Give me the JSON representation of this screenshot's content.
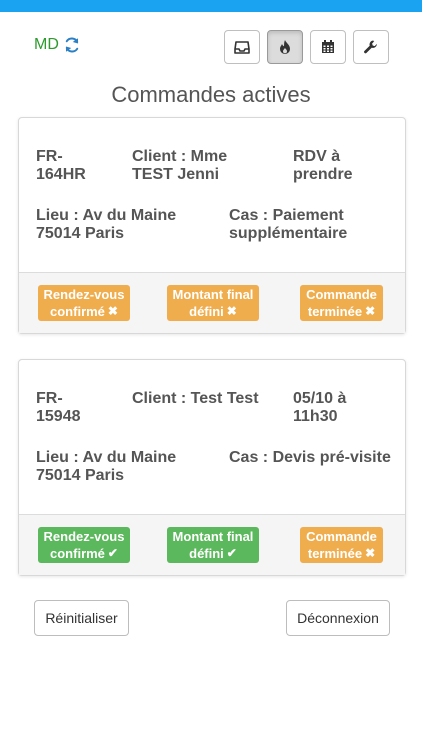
{
  "header": {
    "brand": "MD",
    "nav_icons": [
      "inbox-icon",
      "fire-icon",
      "calendar-icon",
      "wrench-icon"
    ],
    "active_icon": "fire-icon"
  },
  "page_title": "Commandes actives",
  "orders": [
    {
      "id_l1": "FR-",
      "id_l2": "164HR",
      "client_l1": "Client : Mme",
      "client_l2": "TEST Jenni",
      "rdv_l1": "RDV à",
      "rdv_l2": "prendre",
      "lieu_l1": "Lieu : Av du Maine",
      "lieu_l2": "75014 Paris",
      "cas_l1": "Cas : Paiement",
      "cas_l2": "supplémentaire",
      "statuses": [
        {
          "l1": "Rendez-vous",
          "l2": "confirmé",
          "mark": "✖",
          "state": "no"
        },
        {
          "l1": "Montant final",
          "l2": "défini",
          "mark": "✖",
          "state": "no"
        },
        {
          "l1": "Commande",
          "l2": "terminée",
          "mark": "✖",
          "state": "no"
        }
      ]
    },
    {
      "id_l1": "FR-",
      "id_l2": "15948",
      "client_l1": "Client : Test Test",
      "client_l2": "",
      "rdv_l1": "05/10 à",
      "rdv_l2": "11h30",
      "lieu_l1": "Lieu : Av du Maine",
      "lieu_l2": "75014 Paris",
      "cas_l1": "Cas : Devis pré-visite",
      "cas_l2": "",
      "statuses": [
        {
          "l1": "Rendez-vous",
          "l2": "confirmé",
          "mark": "✔",
          "state": "yes"
        },
        {
          "l1": "Montant final",
          "l2": "défini",
          "mark": "✔",
          "state": "yes"
        },
        {
          "l1": "Commande",
          "l2": "terminée",
          "mark": "✖",
          "state": "no"
        }
      ]
    }
  ],
  "actions": {
    "reset_label": "Réinitialiser",
    "logout_label": "Déconnexion"
  },
  "colors": {
    "accent": "#1aa3f0",
    "brand_green": "#2e9a2e",
    "status_pending": "#f0ad4e",
    "status_done": "#5cb85c"
  }
}
